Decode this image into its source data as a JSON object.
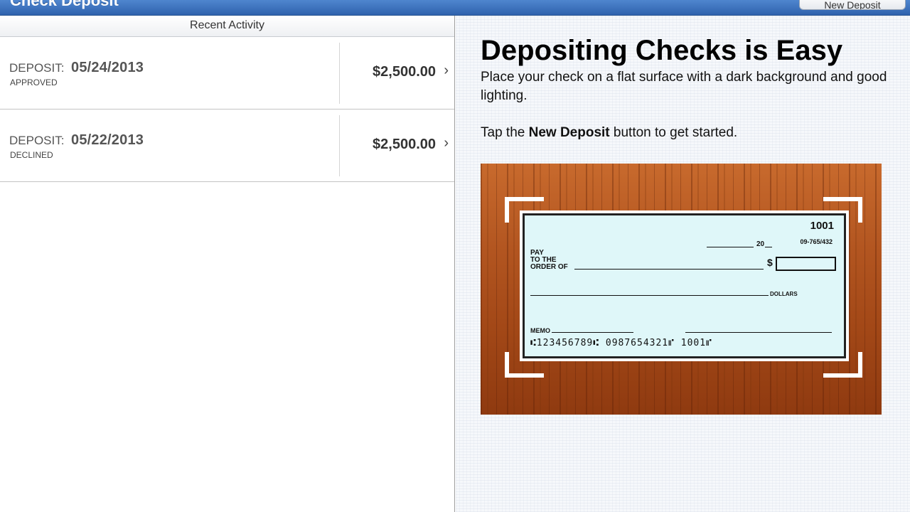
{
  "header": {
    "title": "Check Deposit",
    "new_deposit_button": "New Deposit"
  },
  "activity": {
    "section_title": "Recent Activity",
    "items": [
      {
        "label": "DEPOSIT:",
        "date": "05/24/2013",
        "status": "APPROVED",
        "amount": "$2,500.00"
      },
      {
        "label": "DEPOSIT:",
        "date": "05/22/2013",
        "status": "DECLINED",
        "amount": "$2,500.00"
      }
    ]
  },
  "info": {
    "title": "Depositing Checks is Easy",
    "instructions": "Place your check on a flat surface with a dark background and good lighting.",
    "tap_prefix": "Tap the",
    "tap_bold": "New Deposit",
    "tap_suffix": "button to get started."
  },
  "check": {
    "number": "1001",
    "routing_fraction": "09-765/432",
    "date_suffix": "20",
    "pay_to_line1": "PAY",
    "pay_to_line2": "TO THE",
    "pay_to_line3": "ORDER OF",
    "dollar_sign": "$",
    "dollars_label": "DOLLARS",
    "memo_label": "MEMO",
    "micr_line": "⑆123456789⑆  0987654321⑈  1001⑈"
  },
  "colors": {
    "header_blue": "#2f62ad",
    "wood": "#a34817",
    "check_bg": "#dff7f9"
  }
}
